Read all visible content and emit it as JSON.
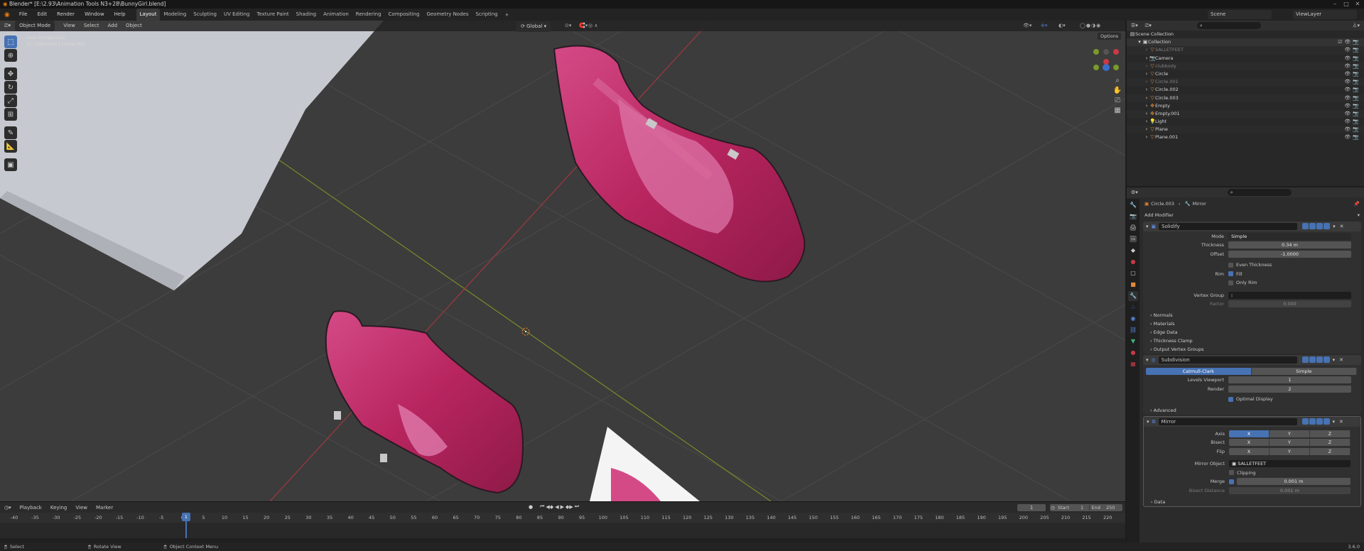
{
  "titlebar": {
    "title": "Blender* [E:\\2.93\\Animation Tools N3+28\\BunnyGirl.blend]"
  },
  "menu": {
    "items": [
      "File",
      "Edit",
      "Render",
      "Window",
      "Help"
    ]
  },
  "workspaces": [
    "Layout",
    "Modeling",
    "Sculpting",
    "UV Editing",
    "Texture Paint",
    "Shading",
    "Animation",
    "Rendering",
    "Compositing",
    "Geometry Nodes",
    "Scripting"
  ],
  "workspace_add": "+",
  "scene": {
    "label": "Scene",
    "viewlayer": "ViewLayer"
  },
  "viewport": {
    "mode": "Object Mode",
    "menus": [
      "View",
      "Select",
      "Add",
      "Object"
    ],
    "orientation": "Global",
    "options": "Options",
    "overlay_line1": "User Perspective",
    "overlay_line2": "(1) Collection | Circle.003"
  },
  "outliner": {
    "root": "Scene Collection",
    "collection": "Collection",
    "items": [
      {
        "name": "SALLETFEET",
        "dim": true
      },
      {
        "name": "Camera",
        "dim": false
      },
      {
        "name": "clubbody",
        "dim": true
      },
      {
        "name": "Circle",
        "dim": false
      },
      {
        "name": "Circle.001",
        "dim": true
      },
      {
        "name": "Circle.002",
        "dim": false
      },
      {
        "name": "Circle.003",
        "dim": false
      },
      {
        "name": "Empty",
        "dim": false
      },
      {
        "name": "Empty.001",
        "dim": false
      },
      {
        "name": "Light",
        "dim": false
      },
      {
        "name": "Plane",
        "dim": false
      },
      {
        "name": "Plane.001",
        "dim": false
      }
    ]
  },
  "properties": {
    "breadcrumb_object": "Circle.003",
    "breadcrumb_modifier": "Mirror",
    "add_modifier": "Add Modifier",
    "solidify": {
      "name": "Solidify",
      "mode_label": "Mode",
      "mode": "Simple",
      "thickness_label": "Thickness",
      "thickness": "0.34 m",
      "offset_label": "Offset",
      "offset": "-1.0000",
      "even_thickness": "Even Thickness",
      "rim_label": "Rim",
      "fill": "Fill",
      "only_rim": "Only Rim",
      "vertex_group_label": "Vertex Group",
      "factor_label": "Factor",
      "factor": "0.000",
      "subpanels": [
        "Normals",
        "Materials",
        "Edge Data",
        "Thickness Clamp",
        "Output Vertex Groups"
      ]
    },
    "subdivision": {
      "name": "Subdivision",
      "types": [
        "Catmull-Clark",
        "Simple"
      ],
      "levels_label": "Levels Viewport",
      "levels": "1",
      "render_label": "Render",
      "render": "2",
      "optimal": "Optimal Display",
      "advanced": "Advanced"
    },
    "mirror": {
      "name": "Mirror",
      "axis_label": "Axis",
      "bisect_label": "Bisect",
      "flip_label": "Flip",
      "axes": [
        "X",
        "Y",
        "Z"
      ],
      "object_label": "Mirror Object",
      "object": "SALLETFEET",
      "clipping": "Clipping",
      "merge_label": "Merge",
      "merge": "0.001 m",
      "bisect_distance_label": "Bisect Distance",
      "bisect_distance": "0.001 m",
      "data": "Data"
    }
  },
  "timeline": {
    "menus": [
      "Playback",
      "Keying",
      "View",
      "Marker"
    ],
    "current_frame": "1",
    "start_label": "Start",
    "start": "1",
    "end_label": "End",
    "end": "250",
    "ticks": [
      "-40",
      "-35",
      "-30",
      "-25",
      "-20",
      "-15",
      "-10",
      "-5",
      "0",
      "5",
      "10",
      "15",
      "20",
      "25",
      "30",
      "35",
      "40",
      "45",
      "50",
      "55",
      "60",
      "65",
      "70",
      "75",
      "80",
      "85",
      "90",
      "95",
      "100",
      "105",
      "110",
      "115",
      "120",
      "125",
      "130",
      "135",
      "140",
      "145",
      "150",
      "155",
      "160",
      "165",
      "170",
      "175",
      "180",
      "185",
      "190",
      "195",
      "200",
      "205",
      "210",
      "215",
      "220"
    ],
    "playhead": "1"
  },
  "statusbar": {
    "select": "Select",
    "rotate": "Rotate View",
    "context": "Object Context Menu",
    "version": "3.6.0"
  },
  "colors": {
    "accent": "#4772b3",
    "shoe": "#c2326e",
    "viewport_bg": "#3c3c3c"
  }
}
